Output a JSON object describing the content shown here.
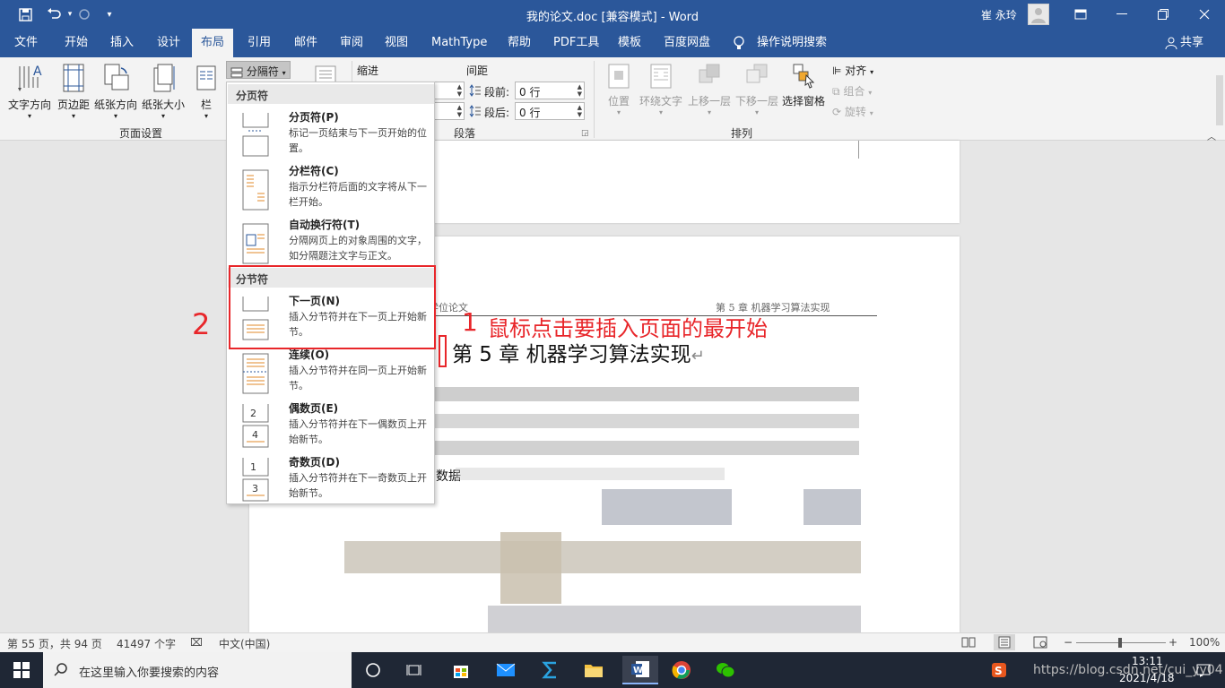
{
  "titlebar": {
    "title": "我的论文.doc [兼容模式]  -  Word",
    "user": "崔 永玲"
  },
  "menu_tabs": [
    "文件",
    "开始",
    "插入",
    "设计",
    "布局",
    "引用",
    "邮件",
    "审阅",
    "视图",
    "MathType",
    "帮助",
    "PDF工具",
    "模板",
    "百度网盘"
  ],
  "tell_me": "操作说明搜索",
  "share": "共享",
  "ribbon": {
    "text_direction": "文字方向",
    "margins": "页边距",
    "orientation": "纸张方向",
    "size": "纸张大小",
    "columns": "栏",
    "breaks": "分隔符",
    "page_setup_label": "页面设置",
    "indent": "缩进",
    "spacing": "间距",
    "before": "段前:",
    "after": "段后:",
    "before_val": "0 行",
    "after_val": "0 行",
    "paragraph_label": "段落",
    "position": "位置",
    "wrap_text": "环绕文字",
    "bring_forward": "上移一层",
    "send_backward": "下移一层",
    "selection_pane": "选择窗格",
    "align": "对齐",
    "group": "组合",
    "rotate": "旋转",
    "arrange_label": "排列"
  },
  "dropdown": {
    "page_breaks_header": "分页符",
    "section_breaks_header": "分节符",
    "items": [
      {
        "title": "分页符(P)",
        "desc": "标记一页结束与下一页开始的位置。"
      },
      {
        "title": "分栏符(C)",
        "desc": "指示分栏符后面的文字将从下一栏开始。"
      },
      {
        "title": "自动换行符(T)",
        "desc": "分隔网页上的对象周围的文字，如分隔题注文字与正文。"
      },
      {
        "title": "下一页(N)",
        "desc": "插入分节符并在下一页上开始新节。"
      },
      {
        "title": "连续(O)",
        "desc": "插入分节符并在同一页上开始新节。"
      },
      {
        "title": "偶数页(E)",
        "desc": "插入分节符并在下一偶数页上开始新节。"
      },
      {
        "title": "奇数页(D)",
        "desc": "插入分节符并在下一奇数页上开始新节。"
      }
    ]
  },
  "document": {
    "header_left": "学位论文",
    "header_right": "第 5 章  机器学习算法实现",
    "heading": "第 5 章  机器学习算法实现",
    "fragment": "数据"
  },
  "annotations": {
    "one": "1",
    "instruction": "鼠标点击要插入页面的最开始",
    "two": "2"
  },
  "status": {
    "page": "第 55 页，共 94 页",
    "words": "41497 个字",
    "language": "中文(中国)",
    "zoom": "100%"
  },
  "taskbar": {
    "search_placeholder": "在这里输入你要搜索的内容",
    "time": "13:11",
    "date": "2021/4/18",
    "watermark": "https://blog.csdn.net/cui_yy04"
  }
}
